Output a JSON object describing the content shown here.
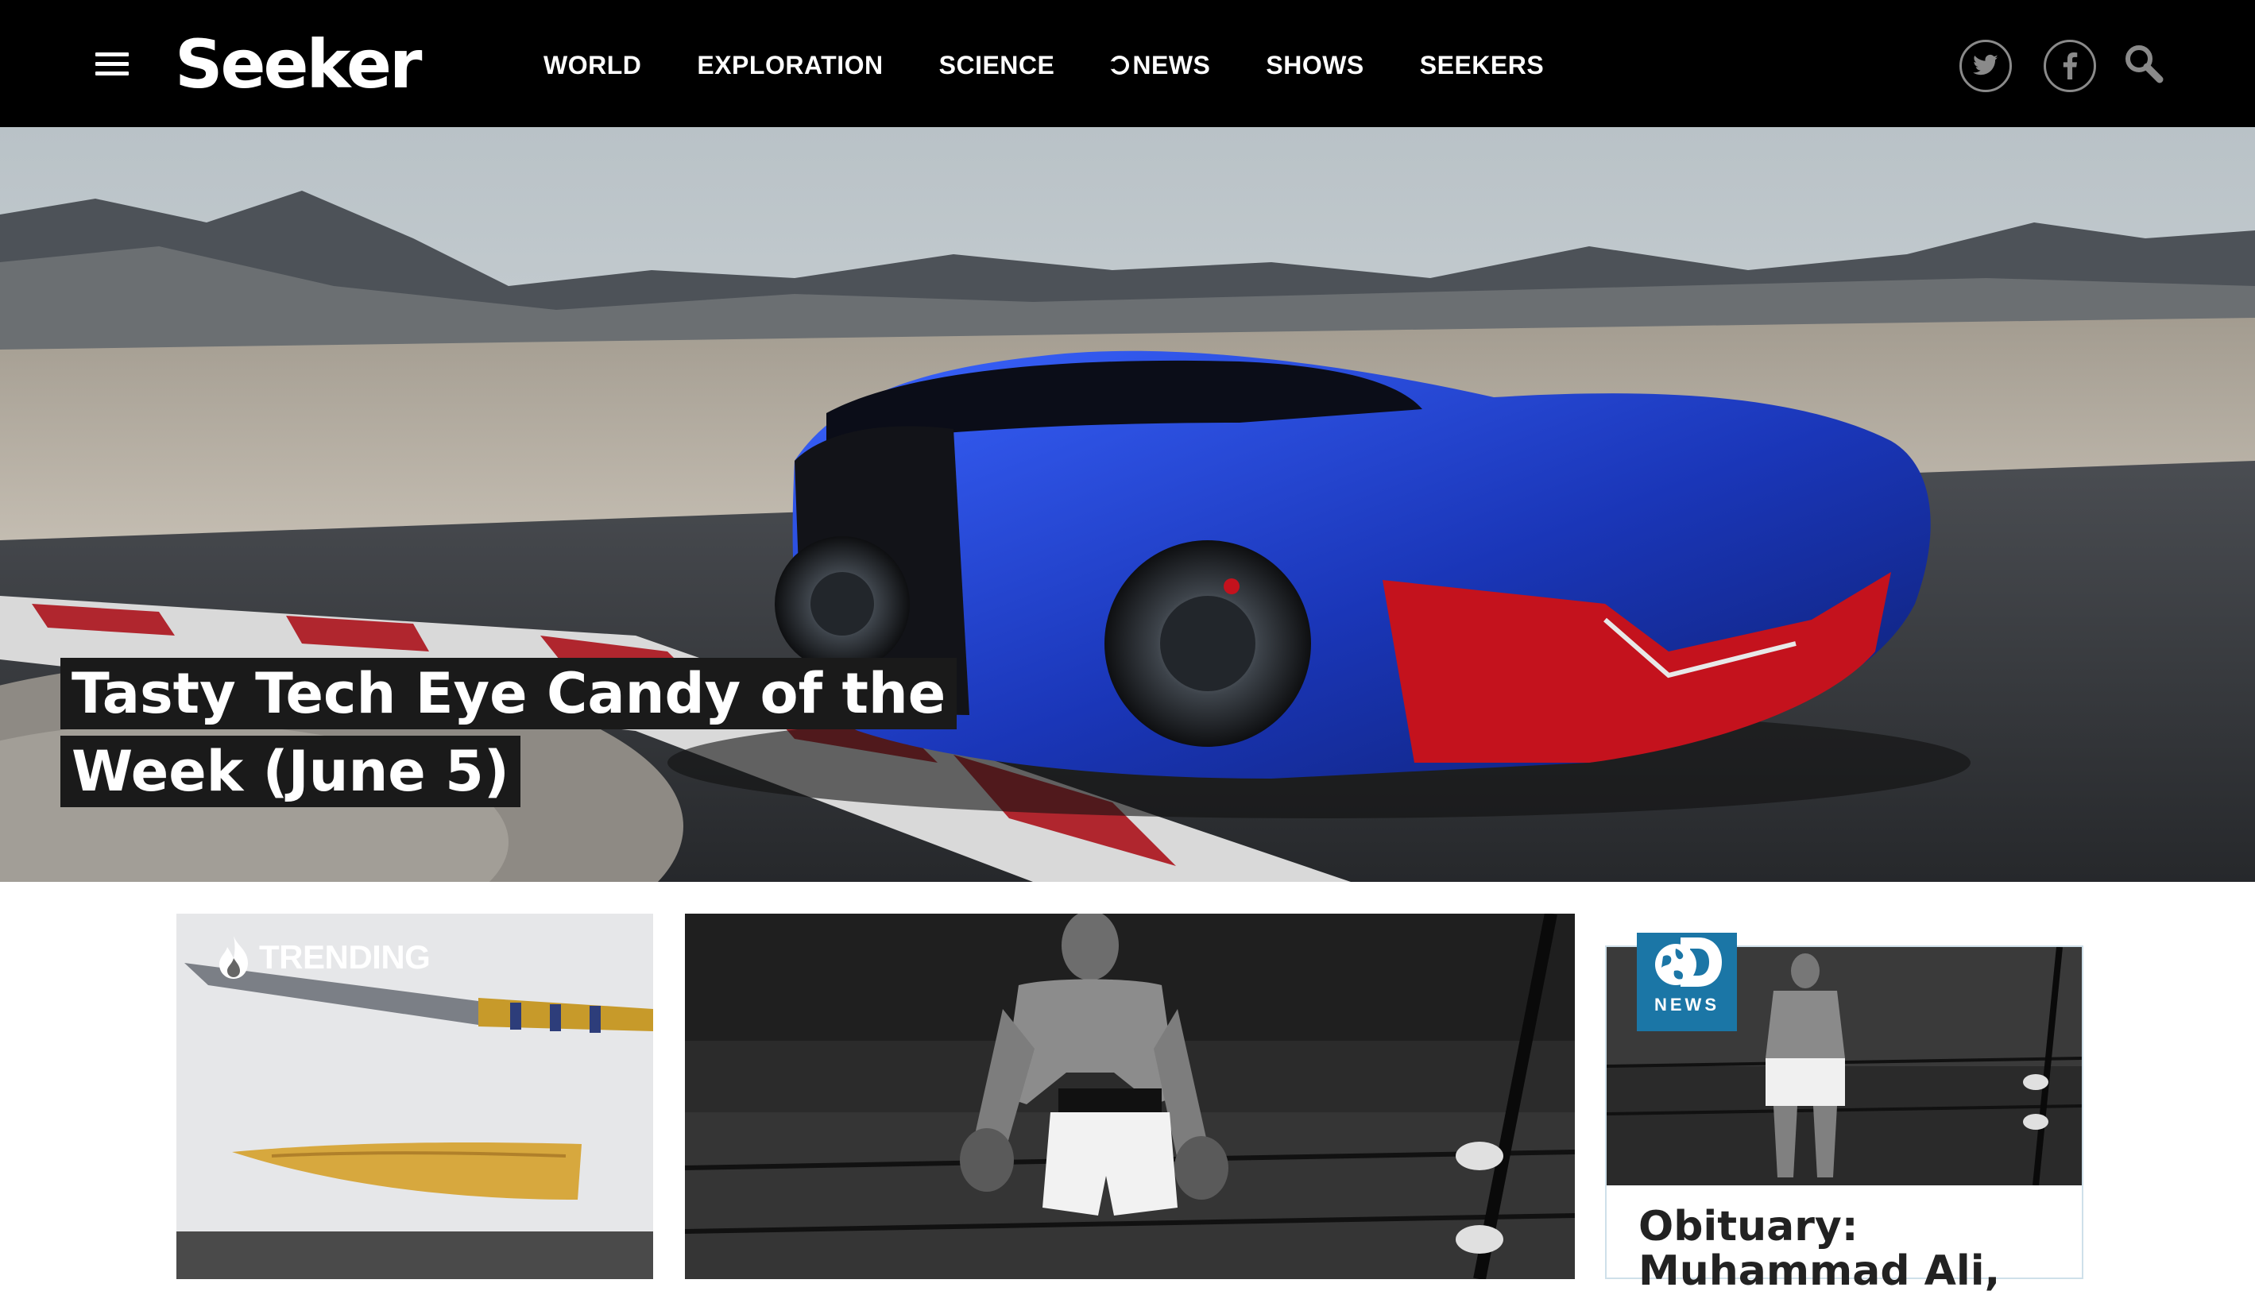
{
  "header": {
    "logo_text": "Seeker",
    "nav": [
      {
        "label": "WORLD"
      },
      {
        "label": "EXPLORATION"
      },
      {
        "label": "SCIENCE"
      },
      {
        "label": "NEWS"
      },
      {
        "label": "SHOWS"
      },
      {
        "label": "SEEKERS"
      }
    ],
    "icons": [
      "menu-icon",
      "twitter-icon",
      "facebook-icon",
      "search-icon"
    ]
  },
  "hero": {
    "title": "Tasty Tech Eye Candy of the Week (June 5)"
  },
  "cards": {
    "trending": {
      "badge": "TRENDING"
    },
    "news": {
      "logo_text": "NEWS",
      "title": "Obituary: Muhammad Ali,"
    }
  },
  "colors": {
    "header_bg": "#000000",
    "dnews_blue": "#1b76a6",
    "car_blue": "#1f3fc4",
    "car_red": "#c4121d"
  }
}
